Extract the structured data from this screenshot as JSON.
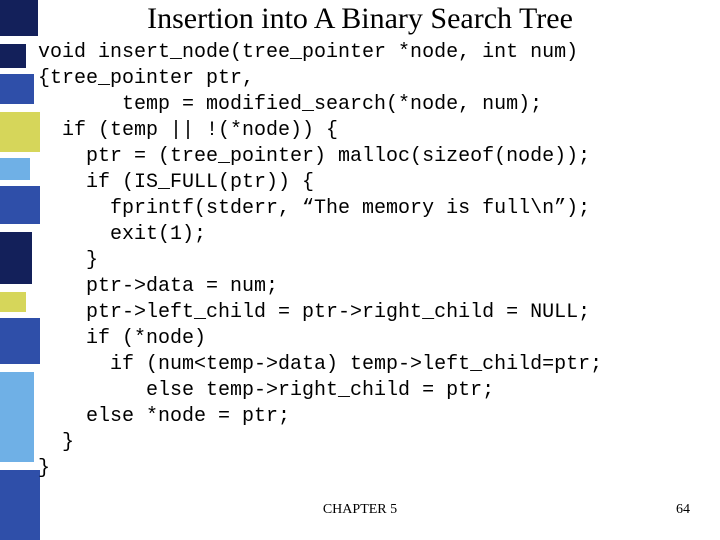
{
  "title": "Insertion into A Binary Search Tree",
  "code_lines": [
    "void insert_node(tree_pointer *node, int num)",
    "{tree_pointer ptr,",
    "       temp = modified_search(*node, num);",
    "  if (temp || !(*node)) {",
    "    ptr = (tree_pointer) malloc(sizeof(node));",
    "    if (IS_FULL(ptr)) {",
    "      fprintf(stderr, “The memory is full\\n”);",
    "      exit(1);",
    "    }",
    "    ptr->data = num;",
    "    ptr->left_child = ptr->right_child = NULL;",
    "    if (*node)",
    "      if (num<temp->data) temp->left_child=ptr;",
    "         else temp->right_child = ptr;",
    "    else *node = ptr;",
    "  }",
    "}"
  ],
  "footer": {
    "chapter": "CHAPTER 5",
    "page": "64"
  }
}
